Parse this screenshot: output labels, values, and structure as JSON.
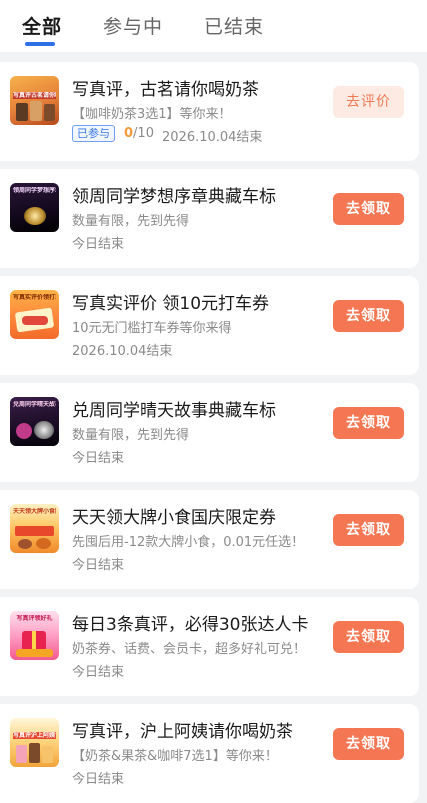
{
  "tabs": [
    {
      "label": "全部"
    },
    {
      "label": "参与中"
    },
    {
      "label": "已结束"
    }
  ],
  "tasks": [
    {
      "thumb_caption": "写真评古茗请你喝奶茶",
      "title": "写真评，古茗请你喝奶茶",
      "desc": "【咖啡奶茶3选1】等你来！",
      "badge": "已参与",
      "progress_current": "0",
      "progress_total": "/10",
      "end": "2026.10.04结束",
      "button": "去评价"
    },
    {
      "thumb_caption": "领周同学梦想序章典藏车标",
      "title": "领周同学梦想序章典藏车标",
      "desc": "数量有限，先到先得",
      "end": "今日结束",
      "button": "去领取"
    },
    {
      "thumb_caption": "写真实评价领打车券",
      "title": "写真实评价 领10元打车券",
      "desc": "10元无门槛打车券等你来得",
      "end": "2026.10.04结束",
      "button": "去领取"
    },
    {
      "thumb_caption": "兑周同学晴天故事典藏车标",
      "title": "兑周同学晴天故事典藏车标",
      "desc": "数量有限，先到先得",
      "end": "今日结束",
      "button": "去领取"
    },
    {
      "thumb_caption": "天天领大牌小食国庆限定券",
      "title": "天天领大牌小食国庆限定券",
      "desc": "先囤后用-12款大牌小食，0.01元任选！",
      "end": "今日结束",
      "button": "去领取"
    },
    {
      "thumb_caption": "写真评领好礼",
      "title": "每日3条真评，必得30张达人卡",
      "desc": "奶茶券、话费、会员卡，超多好礼可兑！",
      "end": "今日结束",
      "button": "去领取"
    },
    {
      "thumb_caption": "写真评沪上阿姨请你喝奶茶",
      "title": "写真评，沪上阿姨请你喝奶茶",
      "desc": "【奶茶&果茶&咖啡7选1】等你来！",
      "end": "今日结束",
      "button": "去领取"
    }
  ],
  "colors": {
    "accent_blue": "#2f6fe6",
    "button_orange": "#f47652",
    "button_light_bg": "#fdebe3",
    "progress_orange": "#f29a3c"
  }
}
